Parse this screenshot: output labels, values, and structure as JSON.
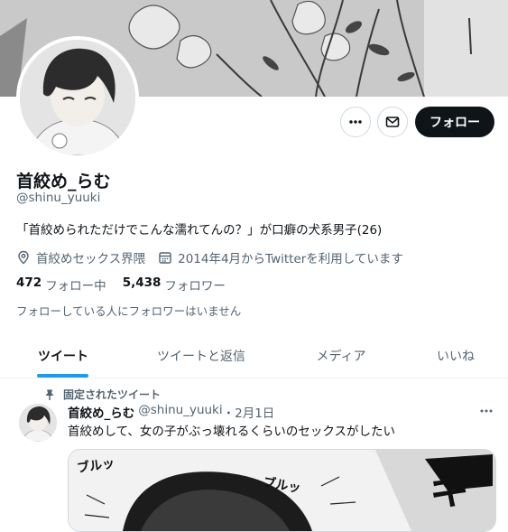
{
  "profile": {
    "display_name": "首絞め_らむ",
    "handle": "@shinu_yuuki",
    "bio": "「首絞められただけでこんな濡れてんの？」が口癖の犬系男子(26)",
    "location": "首絞めセックス界隈",
    "joined": "2014年4月からTwitterを利用しています",
    "following_count": "472",
    "following_label": "フォロー中",
    "followers_count": "5,438",
    "followers_label": "フォロワー",
    "followers_you_know": "フォローしている人にフォロワーはいません"
  },
  "actions": {
    "more_icon": "more-horizontal-icon",
    "message_icon": "envelope-icon",
    "follow_label": "フォロー"
  },
  "tabs": [
    {
      "label": "ツイート",
      "active": true
    },
    {
      "label": "ツイートと返信",
      "active": false
    },
    {
      "label": "メディア",
      "active": false
    },
    {
      "label": "いいね",
      "active": false
    }
  ],
  "pinned_tweet": {
    "pinned_label": "固定されたツイート",
    "author_name": "首絞め_らむ",
    "author_handle": "@shinu_yuuki",
    "date": "・2月1日",
    "text": "首絞めして、女の子がぶっ壊れるくらいのセックスがしたい",
    "media_sfx": [
      "ブルッ",
      "ブルッ",
      "キ"
    ]
  },
  "colors": {
    "accent": "#1d9bf0",
    "text_primary": "#0f1419",
    "text_secondary": "#536471",
    "follow_button": "#0f1419",
    "border": "#cfd9de"
  }
}
